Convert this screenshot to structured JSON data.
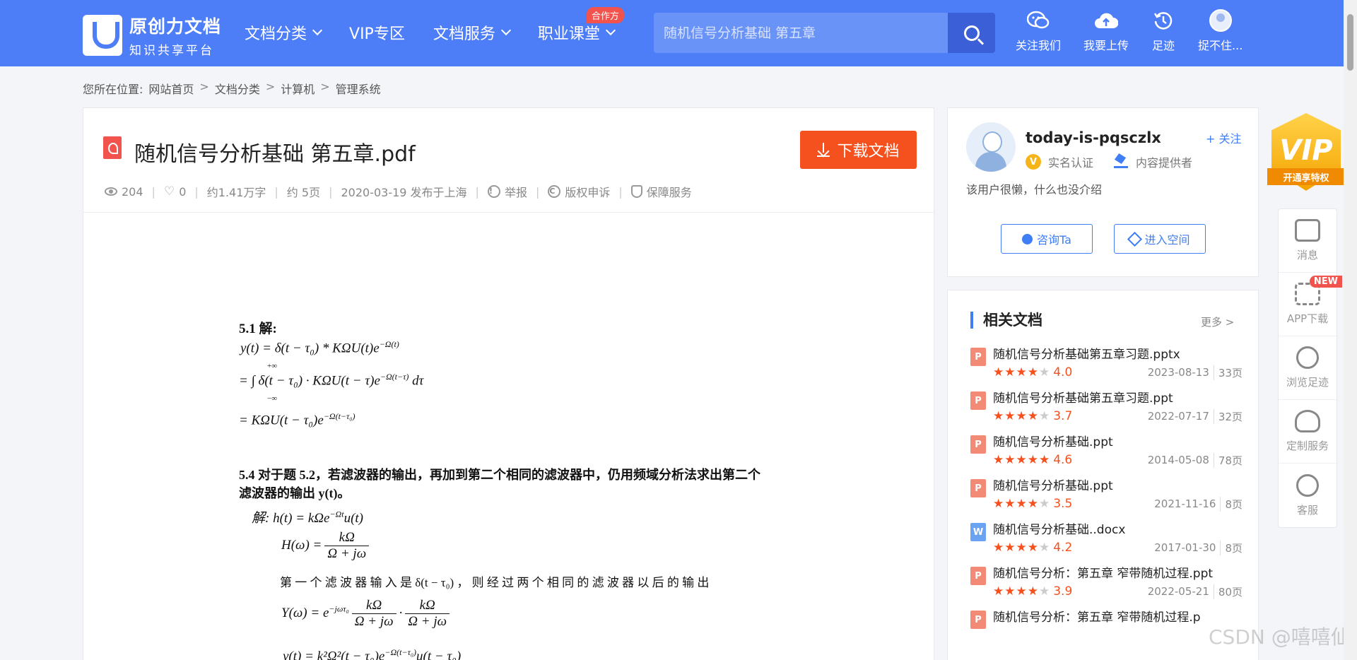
{
  "header": {
    "logo_title": "原创力文档",
    "logo_subtitle": "知识共享平台",
    "nav": [
      {
        "label": "文档分类",
        "dropdown": true
      },
      {
        "label": "VIP专区",
        "dropdown": false
      },
      {
        "label": "文档服务",
        "dropdown": true
      },
      {
        "label": "职业课堂",
        "dropdown": true,
        "badge": "合作方"
      }
    ],
    "search_placeholder": "随机信号分析基础 第五章",
    "tools": [
      "关注我们",
      "我要上传",
      "足迹",
      "捉不住..."
    ]
  },
  "breadcrumb": {
    "prefix": "您所在位置:",
    "items": [
      "网站首页",
      "文档分类",
      "计算机",
      "管理系统"
    ],
    "sep": ">"
  },
  "doc": {
    "title": "随机信号分析基础 第五章.pdf",
    "download_label": "下载文档",
    "views": "204",
    "likes": "0",
    "words": "约1.41万字",
    "pages": "约 5页",
    "published": "2020-03-19 发布于上海",
    "report": "举报",
    "copyright": "版权申诉",
    "guarantee": "保障服务"
  },
  "page_content": {
    "l1_head": "5.1  解:",
    "l2": "y(t) = δ(t − τ₀) * KΩU(t)e",
    "l2_sup": "−Ω(t)",
    "l3": "= ∫ δ(t − τ₀) · KΩU(t − τ)e",
    "l3_sup": "−Ω(t−τ)",
    "l3_tail": "dτ",
    "l3_upper": "+∞",
    "l3_lower": "−∞",
    "l4": "= KΩU(t − τ₀)e",
    "l4_sup": "−Ω(t−τ₀)",
    "l5": "5.4  对于题 5.2，若滤波器的输出，再加到第二个相同的滤波器中，仍用频域分析法求出第二个",
    "l6": "滤波器的输出 y(t)。",
    "l7": "解:  h(t) = kΩe",
    "l7_sup": "−Ωt",
    "l7_tail": "u(t)",
    "l8_lhs": "H(ω) =",
    "frac_num": "kΩ",
    "frac_den": "Ω + jω",
    "l9": "第 一 个 滤 波 器 输 入 是  δ(t − τ₀) ， 则 经 过 两 个 相 同 的 滤 波 器 以 后 的 输 出",
    "l10_lhs": "Y(ω) = e",
    "l10_sup": "−jωτ₀",
    "l10_dot": "·",
    "l11": "y(t) = k²Ω²(t − τ₀)e",
    "l11_sup": "−Ω(t−τ₀)",
    "l11_tail": "u(t − τ₀)"
  },
  "author": {
    "name": "today-is-pqsczlx",
    "follow": "+ 关注",
    "badge_verified": "实名认证",
    "badge_provider": "内容提供者",
    "bio": "该用户很懒，什么也没介绍",
    "consult": "咨询Ta",
    "space": "进入空间"
  },
  "related": {
    "title": "相关文档",
    "more": "更多 >",
    "items": [
      {
        "type": "P",
        "title": "随机信号分析基础第五章习题.pptx",
        "rating": 4.0,
        "stars": "★★★★",
        "off": "★",
        "score": "4.0",
        "date": "2023-08-13",
        "pages": "33页"
      },
      {
        "type": "P",
        "title": "随机信号分析基础第五章习题.ppt",
        "rating": 3.7,
        "stars": "★★★★",
        "off": "★",
        "score": "3.7",
        "date": "2022-07-17",
        "pages": "32页"
      },
      {
        "type": "P",
        "title": "随机信号分析基础.ppt",
        "rating": 4.6,
        "stars": "★★★★★",
        "off": "",
        "score": "4.6",
        "date": "2014-05-08",
        "pages": "78页"
      },
      {
        "type": "P",
        "title": "随机信号分析基础.ppt",
        "rating": 3.5,
        "stars": "★★★★",
        "off": "★",
        "score": "3.5",
        "date": "2021-11-16",
        "pages": "8页"
      },
      {
        "type": "W",
        "title": "随机信号分析基础..docx",
        "rating": 4.2,
        "stars": "★★★★",
        "off": "★",
        "score": "4.2",
        "date": "2017-01-30",
        "pages": "8页"
      },
      {
        "type": "P",
        "title": "随机信号分析：第五章 窄带随机过程.ppt",
        "rating": 3.9,
        "stars": "★★★★",
        "off": "★",
        "score": "3.9",
        "date": "2022-05-21",
        "pages": "80页"
      },
      {
        "type": "P",
        "title": "随机信号分析：第五章 窄带随机过程.p",
        "rating": 0,
        "stars": "",
        "off": "",
        "score": "",
        "date": "",
        "pages": ""
      }
    ]
  },
  "vip": {
    "text": "VIP",
    "ribbon": "开通享特权"
  },
  "side": [
    {
      "label": "消息",
      "icon": "message-icon"
    },
    {
      "label": "APP下载",
      "icon": "scan-icon",
      "badge": "NEW"
    },
    {
      "label": "浏览足迹",
      "icon": "history-icon"
    },
    {
      "label": "定制服务",
      "icon": "heart-icon"
    },
    {
      "label": "客服",
      "icon": "headset-icon"
    }
  ],
  "watermark": "CSDN @嘻嘻仙人",
  "colors": {
    "brand": "#4d7ef7",
    "download": "#f4511e",
    "accent": "#3f7ef5"
  }
}
